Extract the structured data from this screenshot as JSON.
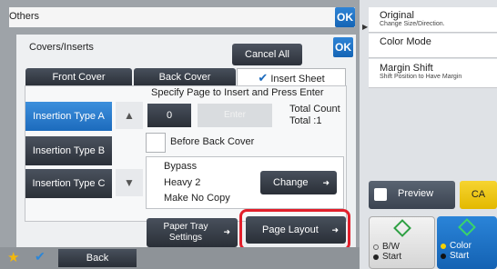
{
  "others": {
    "title": "Others",
    "ok": "OK"
  },
  "right_panel": {
    "items": [
      {
        "title": "Original",
        "sub": "Change Size/Direction."
      },
      {
        "title": "Color Mode",
        "sub": ""
      },
      {
        "title": "Margin Shift",
        "sub": "Shift Position to Have Margin"
      }
    ],
    "preview": "Preview",
    "ca": "CA",
    "bw_line1": "B/W",
    "bw_line2": "Start",
    "color_line1": "Color",
    "color_line2": "Start"
  },
  "covers": {
    "title": "Covers/Inserts",
    "ok": "OK",
    "cancel_all": "Cancel All",
    "tabs": [
      "Front Cover",
      "Back Cover",
      "Insert Sheet"
    ],
    "instruction": "Specify Page to Insert and Press Enter",
    "insertion_types": [
      "Insertion Type A",
      "Insertion Type B",
      "Insertion Type C"
    ],
    "page_value": "0",
    "enter": "Enter",
    "total_count_label": "Total Count",
    "total_value": "Total  :1",
    "before_back_cover": "Before Back Cover",
    "paper": {
      "tray": "Bypass",
      "type": "Heavy 2",
      "make_no_copy": "Make No Copy"
    },
    "change": "Change",
    "paper_tray_settings_1": "Paper Tray",
    "paper_tray_settings_2": "Settings",
    "page_layout": "Page Layout"
  },
  "bottom": {
    "back": "Back"
  },
  "colors": {
    "accent_blue": "#1c6bbd",
    "highlight_red": "#e21f2b",
    "ca_yellow": "#f6d431"
  }
}
